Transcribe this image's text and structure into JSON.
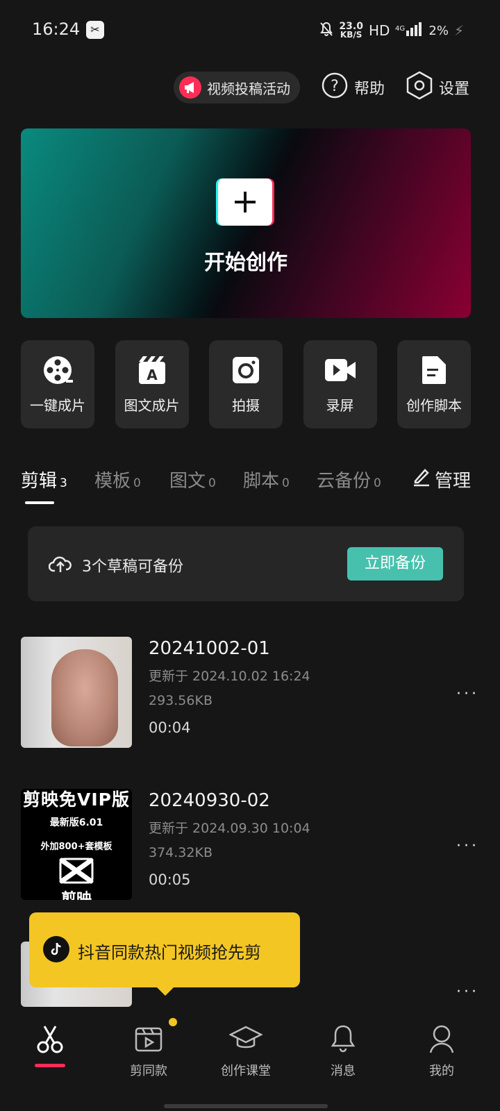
{
  "status_bar": {
    "time": "16:24",
    "net_speed_value": "23.0",
    "net_speed_unit": "KB/S",
    "hd": "HD",
    "network": "4G",
    "battery": "2%"
  },
  "top_bar": {
    "activity_label": "视频投稿活动",
    "help_label": "帮助",
    "settings_label": "设置"
  },
  "hero": {
    "label": "开始创作"
  },
  "tools": [
    {
      "label": "一键成片"
    },
    {
      "label": "图文成片"
    },
    {
      "label": "拍摄"
    },
    {
      "label": "录屏"
    },
    {
      "label": "创作脚本"
    }
  ],
  "tabs": [
    {
      "label": "剪辑",
      "count": "3"
    },
    {
      "label": "模板",
      "count": "0"
    },
    {
      "label": "图文",
      "count": "0"
    },
    {
      "label": "脚本",
      "count": "0"
    },
    {
      "label": "云备份",
      "count": "0"
    }
  ],
  "manage_label": "管理",
  "backup": {
    "text": "3个草稿可备份",
    "button": "立即备份"
  },
  "drafts": [
    {
      "title": "20241002-01",
      "updated": "更新于 2024.10.02 16:24",
      "size": "293.56KB",
      "duration": "00:04"
    },
    {
      "title": "20240930-02",
      "updated": "更新于 2024.09.30 10:04",
      "size": "374.32KB",
      "duration": "00:05"
    }
  ],
  "promo_thumb": {
    "line1": "剪映免VIP版",
    "line2": "最新版6.01",
    "line3": "外加800+套模板",
    "line5": "剪映"
  },
  "toast": {
    "text": "抖音同款热门视频抢先剪"
  },
  "bottom_nav": [
    {
      "label": ""
    },
    {
      "label": "剪同款"
    },
    {
      "label": "创作课堂"
    },
    {
      "label": "消息"
    },
    {
      "label": "我的"
    }
  ],
  "colors": {
    "accent_teal": "#47c1ad",
    "accent_red": "#fe2c55",
    "toast_yellow": "#f4c623",
    "background": "#161616"
  }
}
